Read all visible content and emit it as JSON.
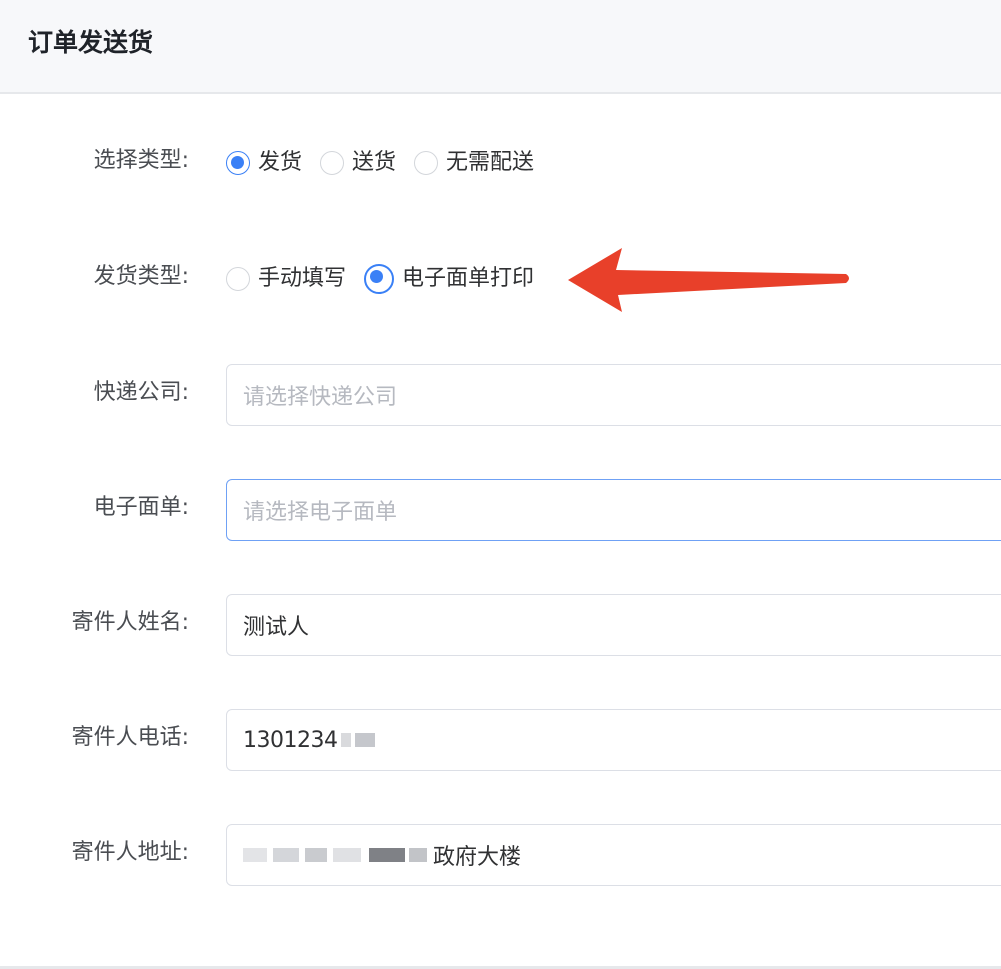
{
  "header": {
    "title": "订单发送货"
  },
  "form": {
    "select_type": {
      "label": "选择类型:",
      "options": [
        {
          "label": "发货",
          "checked": true
        },
        {
          "label": "送货",
          "checked": false
        },
        {
          "label": "无需配送",
          "checked": false
        }
      ]
    },
    "ship_type": {
      "label": "发货类型:",
      "options": [
        {
          "label": "手动填写",
          "checked": false
        },
        {
          "label": "电子面单打印",
          "checked": true
        }
      ]
    },
    "courier": {
      "label": "快递公司:",
      "placeholder": "请选择快递公司",
      "value": ""
    },
    "waybill": {
      "label": "电子面单:",
      "placeholder": "请选择电子面单",
      "value": ""
    },
    "sender_name": {
      "label": "寄件人姓名:",
      "value": "测试人"
    },
    "sender_phone": {
      "label": "寄件人电话:",
      "value": "1301234"
    },
    "sender_address": {
      "label": "寄件人地址:",
      "value": "政府大楼"
    }
  },
  "annotation": {
    "arrow_color": "#e8402a"
  },
  "colors": {
    "accent": "#3a80f6",
    "header_bg": "#f7f8fa",
    "border": "#dcdfe6"
  }
}
